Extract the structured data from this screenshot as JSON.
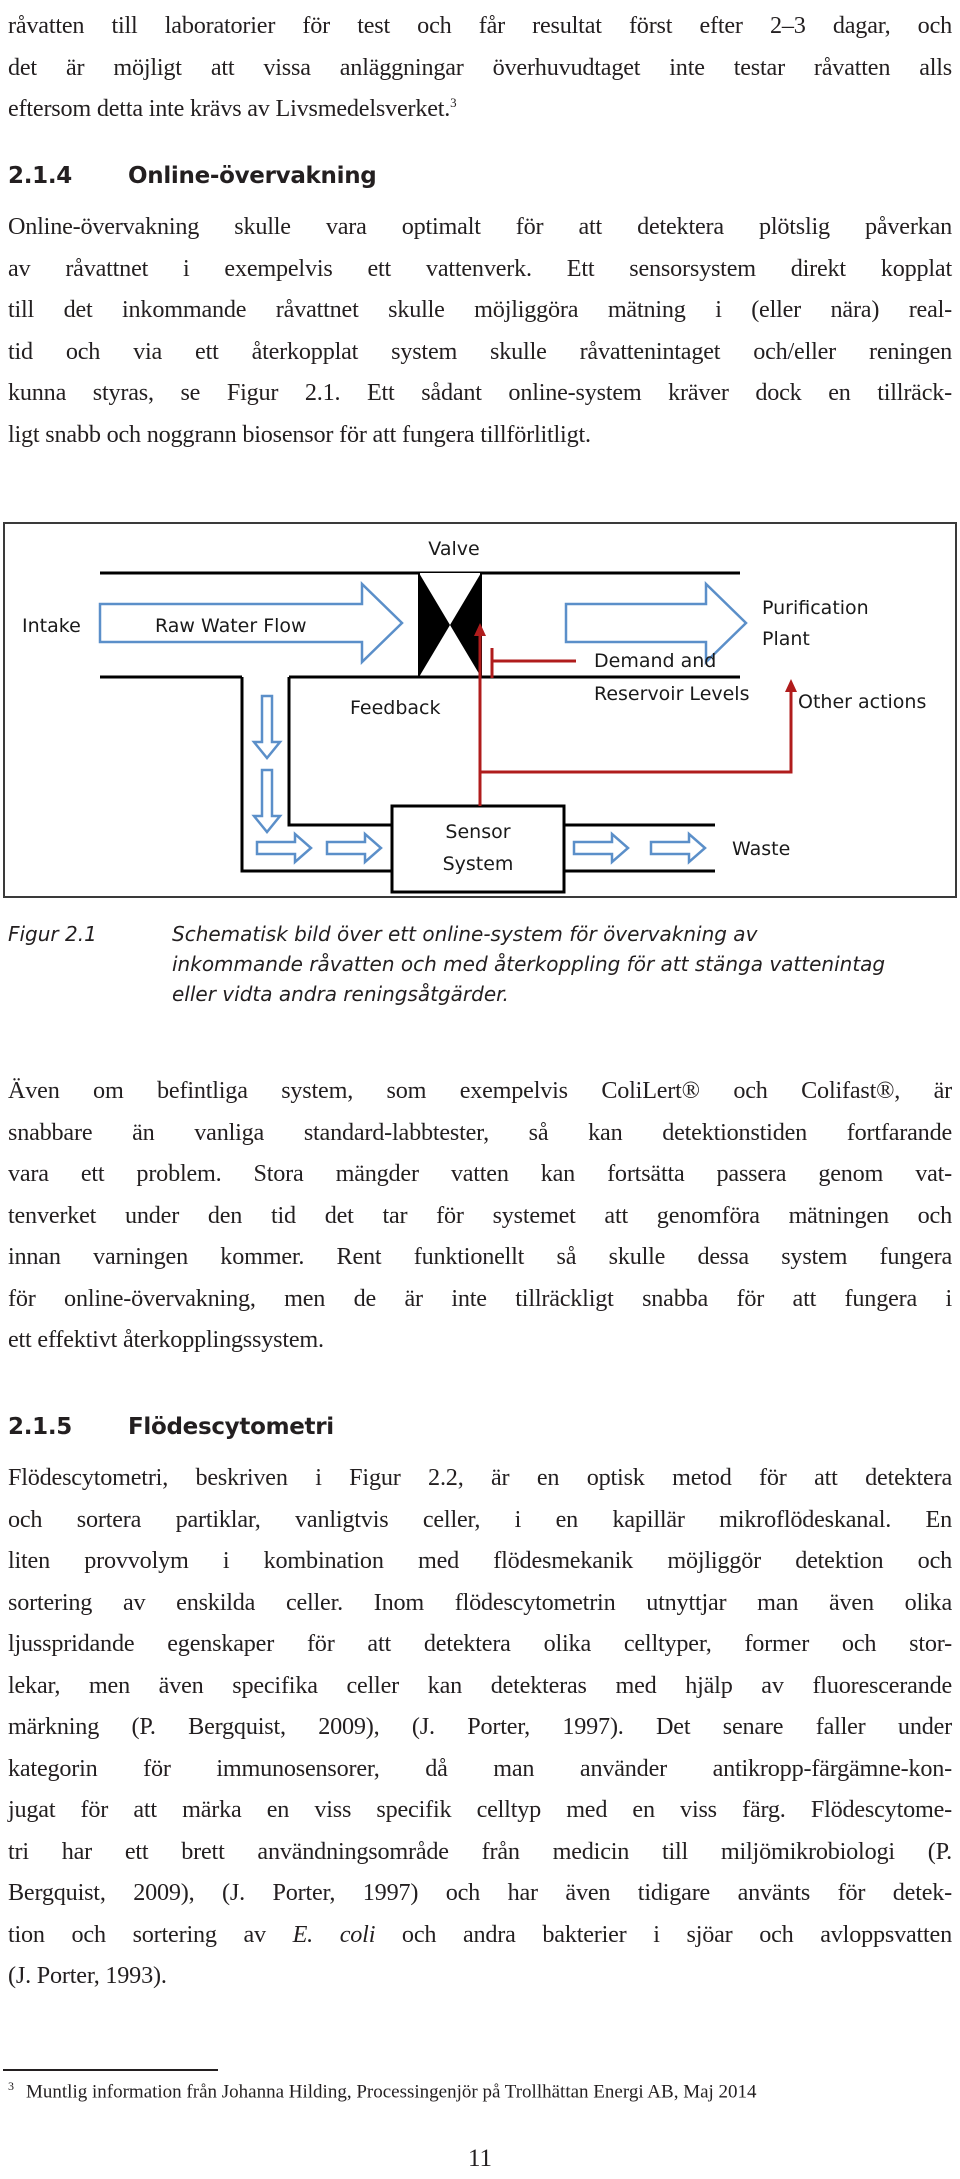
{
  "intro_paragraph": {
    "lines": [
      "råvatten till laboratorier för test och får resultat först efter 2–3 dagar, och",
      "det är möjligt att vissa anläggningar överhuvudtaget inte testar råvatten alls",
      "eftersom detta inte krävs av Livsmedelsverket."
    ],
    "footnote_ref": "3"
  },
  "section_214": {
    "number": "2.1.4",
    "title": "Online-övervakning",
    "lines": [
      "Online-övervakning skulle vara optimalt för att detektera plötslig påverkan",
      "av råvattnet i exempelvis ett vattenverk. Ett sensorsystem direkt kopplat",
      "till det inkommande råvattnet skulle möjliggöra mätning i (eller nära) real-",
      "tid och via ett återkopplat system skulle råvattenintaget och/eller reningen",
      "kunna styras, se Figur 2.1. Ett sådant online-system kräver dock en tillräck-",
      "ligt snabb och noggrann biosensor för att fungera tillförlitligt."
    ]
  },
  "figure": {
    "labels": {
      "valve": "Valve",
      "intake": "Intake",
      "raw_water_flow": "Raw Water Flow",
      "purification_line1": "Purification",
      "purification_line2": "Plant",
      "demand_line1": "Demand and",
      "demand_line2": "Reservoir Levels",
      "other_actions": "Other actions",
      "feedback": "Feedback",
      "sensor_line1": "Sensor",
      "sensor_line2": "System",
      "waste": "Waste"
    },
    "colors": {
      "flow_arrow": "#5b8fc9",
      "feedback": "#b01c1c",
      "pipe": "#000000"
    },
    "caption_number": "Figur 2.1",
    "caption_text": "Schematisk bild över ett online-system för övervakning av inkommande råvatten och med återkoppling för att stänga vattenintag eller vidta andra reningsåtgärder."
  },
  "paragraph_after_figure": {
    "lines": [
      "Även om befintliga system, som exempelvis ColiLert® och Colifast®, är",
      "snabbare än vanliga standard-labbtester, så kan detektionstiden fortfarande",
      "vara ett problem. Stora mängder vatten kan fortsätta passera genom vat-",
      "tenverket under den tid det tar för systemet att genomföra mätningen och",
      "innan varningen kommer. Rent funktionellt så skulle dessa system fungera",
      "för online-övervakning, men de är inte tillräckligt snabba för att fungera i",
      "ett effektivt återkopplingssystem."
    ]
  },
  "section_215": {
    "number": "2.1.5",
    "title": "Flödescytometri",
    "lines": [
      "Flödescytometri, beskriven i Figur 2.2, är en optisk metod för att detektera",
      "och sortera partiklar, vanligtvis celler, i en kapillär mikroflödeskanal. En",
      "liten provvolym i kombination med flödesmekanik möjliggör detektion och",
      "sortering av enskilda celler. Inom flödescytometrin utnyttjar man även olika",
      "ljusspridande egenskaper för att detektera olika celltyper, former och stor-",
      "lekar, men även specifika celler kan detekteras med hjälp av fluorescerande",
      "märkning (P. Bergquist, 2009), (J. Porter, 1997). Det senare faller under",
      "kategorin för immunosensorer, då man använder antikropp-färgämne-kon-",
      "jugat för att märka en viss specifik celltyp med en viss färg. Flödescytome-",
      "tri har ett brett användningsområde från medicin till miljömikrobiologi (P.",
      "Bergquist, 2009), (J. Porter, 1997) och har även tidigare använts för detek-"
    ],
    "line_12_before": "tion och sortering av ",
    "line_12_italic": "E. coli",
    "line_12_after": " och andra bakterier i sjöar och avloppsvatten",
    "last_line": "(J. Porter, 1993)."
  },
  "footnote": {
    "mark": "3",
    "text": "Muntlig information från Johanna Hilding, Processingenjör på Trollhättan Energi AB, Maj 2014"
  },
  "page_number": "11"
}
